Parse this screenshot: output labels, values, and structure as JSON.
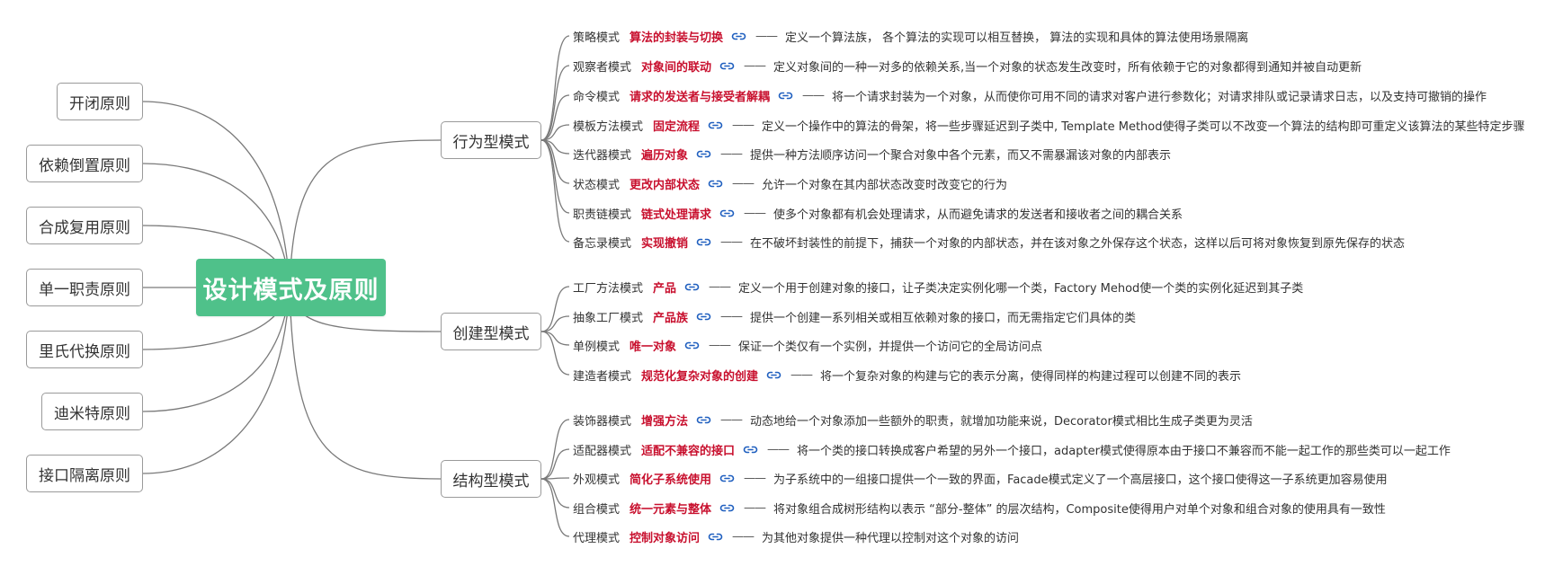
{
  "root": {
    "label": "设计模式及原则"
  },
  "principles": [
    {
      "label": "开闭原则"
    },
    {
      "label": "依赖倒置原则"
    },
    {
      "label": "合成复用原则"
    },
    {
      "label": "单一职责原则"
    },
    {
      "label": "里氏代换原则"
    },
    {
      "label": "迪米特原则"
    },
    {
      "label": "接口隔离原则"
    }
  ],
  "categories": [
    {
      "label": "行为型模式",
      "patterns": [
        {
          "name": "策略模式",
          "keyword": "算法的封装与切换",
          "dash": "——",
          "description": "定义一个算法族， 各个算法的实现可以相互替换， 算法的实现和具体的算法使用场景隔离"
        },
        {
          "name": "观察者模式",
          "keyword": "对象间的联动",
          "dash": "——",
          "description": "定义对象间的一种一对多的依赖关系,当一个对象的状态发生改变时，所有依赖于它的对象都得到通知并被自动更新"
        },
        {
          "name": "命令模式",
          "keyword": "请求的发送者与接受者解耦",
          "dash": "——",
          "description": "将一个请求封装为一个对象，从而使你可用不同的请求对客户进行参数化；对请求排队或记录请求日志，以及支持可撤销的操作"
        },
        {
          "name": "模板方法模式",
          "keyword": "固定流程",
          "dash": "——",
          "description": "定义一个操作中的算法的骨架，将一些步骤延迟到子类中, Template Method使得子类可以不改变一个算法的结构即可重定义该算法的某些特定步骤"
        },
        {
          "name": "迭代器模式",
          "keyword": "遍历对象",
          "dash": "——",
          "description": "提供一种方法顺序访问一个聚合对象中各个元素，而又不需暴漏该对象的内部表示"
        },
        {
          "name": "状态模式",
          "keyword": "更改内部状态",
          "dash": "——",
          "description": "允许一个对象在其内部状态改变时改变它的行为"
        },
        {
          "name": "职责链模式",
          "keyword": "链式处理请求",
          "dash": "——",
          "description": "使多个对象都有机会处理请求，从而避免请求的发送者和接收者之间的耦合关系"
        },
        {
          "name": "备忘录模式",
          "keyword": "实现撤销",
          "dash": "——",
          "description": "在不破坏封装性的前提下，捕获一个对象的内部状态，并在该对象之外保存这个状态，这样以后可将对象恢复到原先保存的状态"
        }
      ]
    },
    {
      "label": "创建型模式",
      "patterns": [
        {
          "name": "工厂方法模式",
          "keyword": "产品",
          "dash": "——",
          "description": "定义一个用于创建对象的接口，让子类决定实例化哪一个类，Factory Mehod使一个类的实例化延迟到其子类"
        },
        {
          "name": "抽象工厂模式",
          "keyword": "产品族",
          "dash": "——",
          "description": "提供一个创建一系列相关或相互依赖对象的接口，而无需指定它们具体的类"
        },
        {
          "name": "单例模式",
          "keyword": "唯一对象",
          "dash": "——",
          "description": "保证一个类仅有一个实例，并提供一个访问它的全局访问点"
        },
        {
          "name": "建造者模式",
          "keyword": "规范化复杂对象的创建",
          "dash": "——",
          "description": "将一个复杂对象的构建与它的表示分离，使得同样的构建过程可以创建不同的表示"
        }
      ]
    },
    {
      "label": "结构型模式",
      "patterns": [
        {
          "name": "装饰器模式",
          "keyword": "增强方法",
          "dash": "——",
          "description": "动态地给一个对象添加一些额外的职责，就增加功能来说，Decorator模式相比生成子类更为灵活"
        },
        {
          "name": "适配器模式",
          "keyword": "适配不兼容的接口",
          "dash": "——",
          "description": "将一个类的接口转换成客户希望的另外一个接口，adapter模式使得原本由于接口不兼容而不能一起工作的那些类可以一起工作"
        },
        {
          "name": "外观模式",
          "keyword": "简化子系统使用",
          "dash": "——",
          "description": "为子系统中的一组接口提供一个一致的界面，Facade模式定义了一个高层接口，这个接口使得这一子系统更加容易使用"
        },
        {
          "name": "组合模式",
          "keyword": "统一元素与整体",
          "dash": "——",
          "description": "将对象组合成树形结构以表示 “部分-整体” 的层次结构，Composite使得用户对单个对象和组合对象的使用具有一致性"
        },
        {
          "name": "代理模式",
          "keyword": "控制对象访问",
          "dash": "——",
          "description": "为其他对象提供一种代理以控制对这个对象的访问"
        }
      ]
    }
  ],
  "colors": {
    "root_bg": "#4fc18a",
    "keyword": "#c8102e",
    "link_icon": "#1f5fbf",
    "line": "#7a7a7a"
  },
  "icons": {
    "pattern_link": "link-icon"
  }
}
